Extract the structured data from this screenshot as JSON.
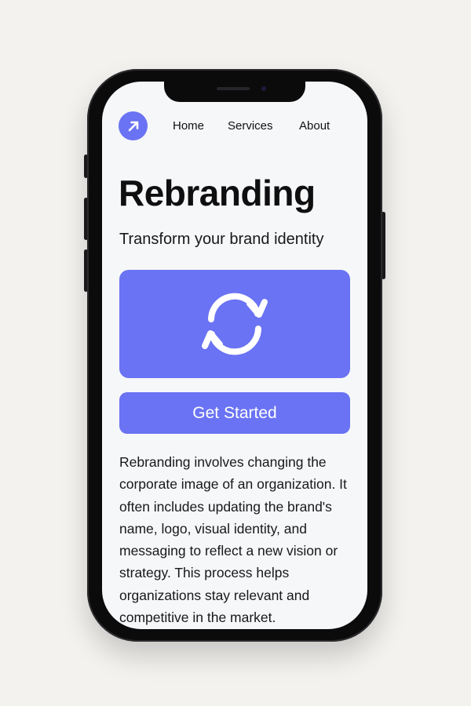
{
  "nav": {
    "logo_icon": "arrow-up-right-icon",
    "links": [
      {
        "label": "Home"
      },
      {
        "label": "Services"
      },
      {
        "label": "About"
      }
    ]
  },
  "hero": {
    "title": "Rebranding",
    "subtitle": "Transform your brand identity",
    "card_icon": "refresh-icon",
    "cta_label": "Get Started"
  },
  "description": "Rebranding involves changing the corporate image of an organization. It often includes updating the brand's name, logo, visual identity, and messaging to reflect a new vision or strategy. This process helps organizations stay relevant and competitive in the market.",
  "colors": {
    "accent": "#6a73f3",
    "screen_background": "#f6f7f9",
    "page_background": "#f4f2ef",
    "text": "#111111"
  }
}
